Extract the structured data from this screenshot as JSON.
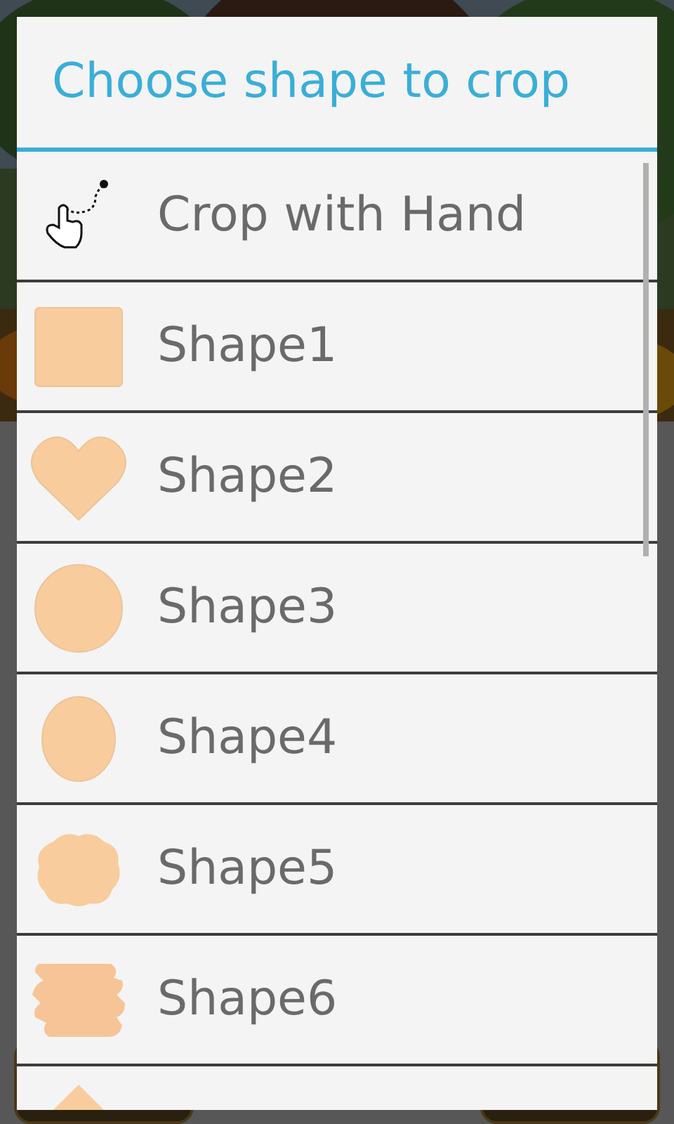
{
  "dialog": {
    "title": "Choose shape to crop"
  },
  "items": [
    {
      "kind": "hand",
      "label": "Crop with Hand"
    },
    {
      "kind": "square",
      "label": "Shape1"
    },
    {
      "kind": "heart",
      "label": "Shape2"
    },
    {
      "kind": "circle",
      "label": "Shape3"
    },
    {
      "kind": "ellipse",
      "label": "Shape4"
    },
    {
      "kind": "cloud",
      "label": "Shape5"
    },
    {
      "kind": "blob",
      "label": "Shape6"
    },
    {
      "kind": "triangle"
    }
  ]
}
